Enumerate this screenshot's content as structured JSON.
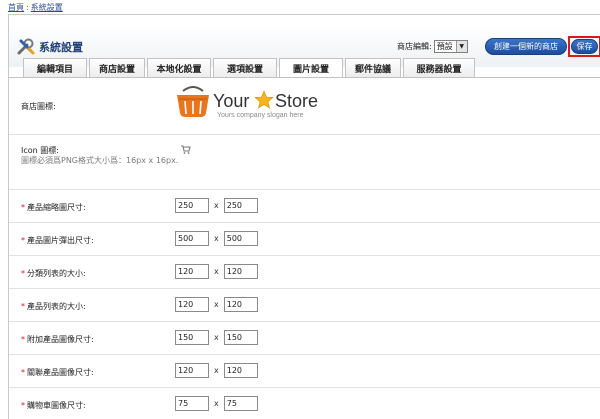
{
  "breadcrumb": {
    "home": "首頁",
    "separator": ":",
    "current": "系統設置"
  },
  "header": {
    "title": "系統設置",
    "store_editor_label": "商店編輯:",
    "store_select_value": "預設",
    "new_store_button": "創建一個新的商店",
    "save_button": "保存"
  },
  "tabs": [
    "編輯項目",
    "商店設置",
    "本地化設置",
    "選項設置",
    "圖片設置",
    "郵件協議",
    "服務器設置"
  ],
  "active_tab": "圖片設置",
  "logo": {
    "text_your": "Your",
    "text_store": "Store",
    "slogan": "Yours company slogan here"
  },
  "fields": {
    "store_logo": {
      "label": "商店圖標:"
    },
    "icon": {
      "label": "Icon 圖標:",
      "hint": "圖標必須爲PNG格式大小爲：16px x 16px."
    },
    "dimension_rows": [
      {
        "label": "產品縮略圖尺寸:",
        "required": "*",
        "width": "250",
        "height": "250"
      },
      {
        "label": "產品圖片彈出尺寸:",
        "required": "*",
        "width": "500",
        "height": "500"
      },
      {
        "label": "分類列表的大小:",
        "required": "*",
        "width": "120",
        "height": "120"
      },
      {
        "label": "產品列表的大小:",
        "required": "*",
        "width": "120",
        "height": "120"
      },
      {
        "label": "附加產品圖像尺寸:",
        "required": "*",
        "width": "150",
        "height": "150"
      },
      {
        "label": "關聯產品圖像尺寸:",
        "required": "*",
        "width": "120",
        "height": "120"
      },
      {
        "label": "購物車圖像尺寸:",
        "required": "*",
        "width": "75",
        "height": "75"
      }
    ],
    "x_separator": "x"
  },
  "colors": {
    "accent_blue": "#1c4d9e",
    "title_blue": "#1f3f7a",
    "required_red": "#d7191c",
    "logo_orange": "#e8761e"
  }
}
